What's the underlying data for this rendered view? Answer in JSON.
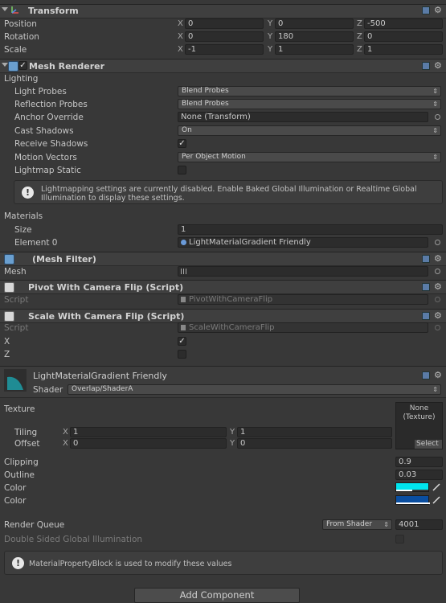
{
  "transform": {
    "title": "Transform",
    "position": {
      "label": "Position",
      "x": "0",
      "y": "0",
      "z": "-500"
    },
    "rotation": {
      "label": "Rotation",
      "x": "0",
      "y": "180",
      "z": "0"
    },
    "scale": {
      "label": "Scale",
      "x": "-1",
      "y": "1",
      "z": "1"
    },
    "axis_x": "X",
    "axis_y": "Y",
    "axis_z": "Z"
  },
  "mesh_renderer": {
    "title": "Mesh Renderer",
    "enabled": true,
    "lighting_label": "Lighting",
    "light_probes": {
      "label": "Light Probes",
      "value": "Blend Probes"
    },
    "reflection_probes": {
      "label": "Reflection Probes",
      "value": "Blend Probes"
    },
    "anchor_override": {
      "label": "Anchor Override",
      "value": "None (Transform)"
    },
    "cast_shadows": {
      "label": "Cast Shadows",
      "value": "On"
    },
    "receive_shadows": {
      "label": "Receive Shadows",
      "checked": true
    },
    "motion_vectors": {
      "label": "Motion Vectors",
      "value": "Per Object Motion"
    },
    "lightmap_static": {
      "label": "Lightmap Static",
      "checked": false
    },
    "info_line1": "Lightmapping settings are currently disabled. Enable Baked Global Illumination or Realtime Global",
    "info_line2": "Illumination to display these settings.",
    "materials_label": "Materials",
    "size": {
      "label": "Size",
      "value": "1"
    },
    "element0": {
      "label": "Element 0",
      "value": "LightMaterialGradient Friendly"
    }
  },
  "mesh_filter": {
    "title": "(Mesh Filter)",
    "mesh_label": "Mesh"
  },
  "pivot_script": {
    "title": "Pivot With Camera Flip (Script)",
    "script_label": "Script",
    "script_value": "PivotWithCameraFlip"
  },
  "scale_script": {
    "title": "Scale With Camera Flip (Script)",
    "script_label": "Script",
    "script_value": "ScaleWithCameraFlip",
    "x_label": "X",
    "x_checked": true,
    "z_label": "Z",
    "z_checked": false
  },
  "material": {
    "name": "LightMaterialGradient Friendly",
    "shader_label": "Shader",
    "shader_value": "Overlap/ShaderA",
    "texture_label": "Texture",
    "texture_none": "None",
    "texture_type": "(Texture)",
    "select_label": "Select",
    "tiling": {
      "label": "Tiling",
      "x": "1",
      "y": "1"
    },
    "offset": {
      "label": "Offset",
      "x": "0",
      "y": "0"
    },
    "clipping": {
      "label": "Clipping",
      "value": "0.9"
    },
    "outline": {
      "label": "Outline",
      "value": "0.03"
    },
    "color1": {
      "label": "Color",
      "hex": "#00e5ee"
    },
    "color2": {
      "label": "Color",
      "hex": "#0a4ea0"
    },
    "render_queue": {
      "label": "Render Queue",
      "mode": "From Shader",
      "value": "4001"
    },
    "double_sided": {
      "label": "Double Sided Global Illumination"
    },
    "info": "MaterialPropertyBlock is used to modify these values"
  },
  "add_component": "Add Component"
}
